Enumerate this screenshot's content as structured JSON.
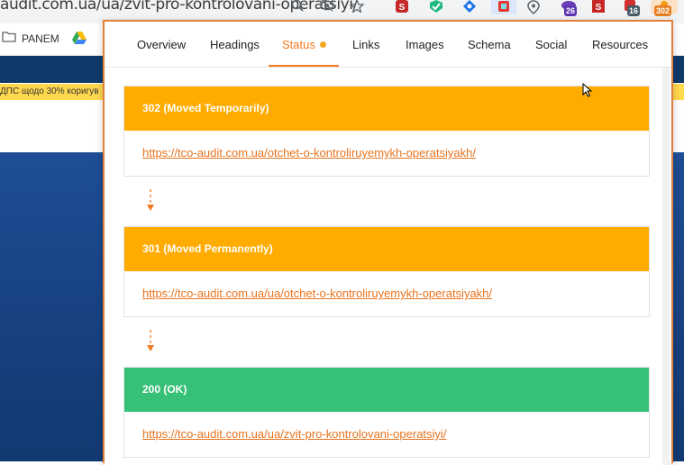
{
  "browser": {
    "url": "audit.com.ua/ua/zvit-pro-kontrolovani-operatsiyi/",
    "extension_badges": {
      "notifications": "26",
      "tabs": "16",
      "status": "302"
    },
    "colors": {
      "chrome": "#f1f3f4"
    }
  },
  "bookmarks": {
    "items": [
      {
        "label": "PANEM",
        "icon": "folder-icon"
      }
    ]
  },
  "website": {
    "notice_text": "ДПС щодо 30% коригув"
  },
  "popup": {
    "tabs": [
      {
        "label": "Overview"
      },
      {
        "label": "Headings"
      },
      {
        "label": "Status"
      },
      {
        "label": "Links"
      },
      {
        "label": "Images"
      },
      {
        "label": "Schema"
      },
      {
        "label": "Social"
      },
      {
        "label": "Resources"
      }
    ],
    "active_tab": "Status",
    "redirects": [
      {
        "status": "302 (Moved Temporarily)",
        "url": "https://tco-audit.com.ua/otchet-o-kontroliruyemykh-operatsiyakh/",
        "color": "#ffab00"
      },
      {
        "status": "301 (Moved Permanently)",
        "url": "https://tco-audit.com.ua/ua/otchet-o-kontroliruyemykh-operatsiyakh/",
        "color": "#ffab00"
      },
      {
        "status": "200 (OK)",
        "url": "https://tco-audit.com.ua/ua/zvit-pro-kontrolovani-operatsiyi/",
        "color": "#36c078"
      }
    ],
    "colors": {
      "accent": "#f47a1f",
      "border": "#e0803a"
    }
  }
}
